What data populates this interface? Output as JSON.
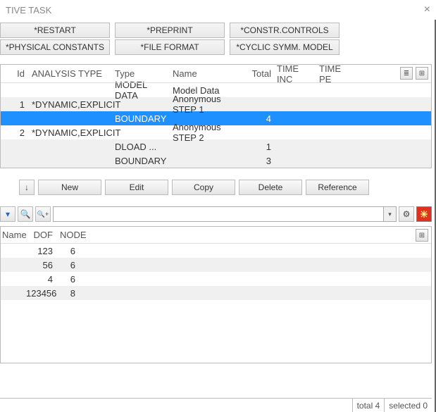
{
  "window": {
    "title_fragment": "TIVE TASK"
  },
  "buttons_grid": {
    "row1": [
      "*RESTART",
      "*PREPRINT",
      "*CONSTR.CONTROLS"
    ],
    "row2": [
      "*PHYSICAL CONSTANTS",
      "*FILE FORMAT",
      "*CYCLIC SYMM. MODEL"
    ]
  },
  "upper_table": {
    "headers": {
      "id": "Id",
      "atype": "ANALYSIS TYPE",
      "type": "Type",
      "name": "Name",
      "total": "Total",
      "tinc": "TIME INC",
      "tper": "TIME PE"
    },
    "rows": [
      {
        "id": "",
        "atype": "",
        "type": "MODEL DATA",
        "name": "Model Data",
        "total": "",
        "alt": false
      },
      {
        "id": "1",
        "atype": "*DYNAMIC,EXPLICIT",
        "type": "",
        "name": "Anonymous STEP 1",
        "total": "",
        "alt": true
      },
      {
        "id": "",
        "atype": "",
        "type": "BOUNDARY",
        "name": "",
        "total": "4",
        "sel": true
      },
      {
        "id": "2",
        "atype": "*DYNAMIC,EXPLICIT",
        "type": "",
        "name": "Anonymous STEP 2",
        "total": "",
        "alt": false
      },
      {
        "id": "",
        "atype": "",
        "type": "DLOAD     ...",
        "name": "",
        "total": "1",
        "alt": true
      },
      {
        "id": "",
        "atype": "",
        "type": "BOUNDARY",
        "name": "",
        "total": "3",
        "alt": false,
        "altbg": true
      }
    ]
  },
  "actions": {
    "new": "New",
    "edit": "Edit",
    "copy": "Copy",
    "delete": "Delete",
    "reference": "Reference"
  },
  "search": {
    "value": ""
  },
  "lower_table": {
    "headers": {
      "name": "Name",
      "dof": "DOF",
      "node": "NODE"
    },
    "rows": [
      {
        "name": "",
        "dof": "123",
        "node": "6",
        "alt": false
      },
      {
        "name": "",
        "dof": "56",
        "node": "6",
        "alt": true
      },
      {
        "name": "",
        "dof": "4",
        "node": "6",
        "alt": false
      },
      {
        "name": "",
        "dof": "123456",
        "node": "8",
        "alt": true
      }
    ]
  },
  "status": {
    "total": "total 4",
    "selected": "selected 0"
  }
}
